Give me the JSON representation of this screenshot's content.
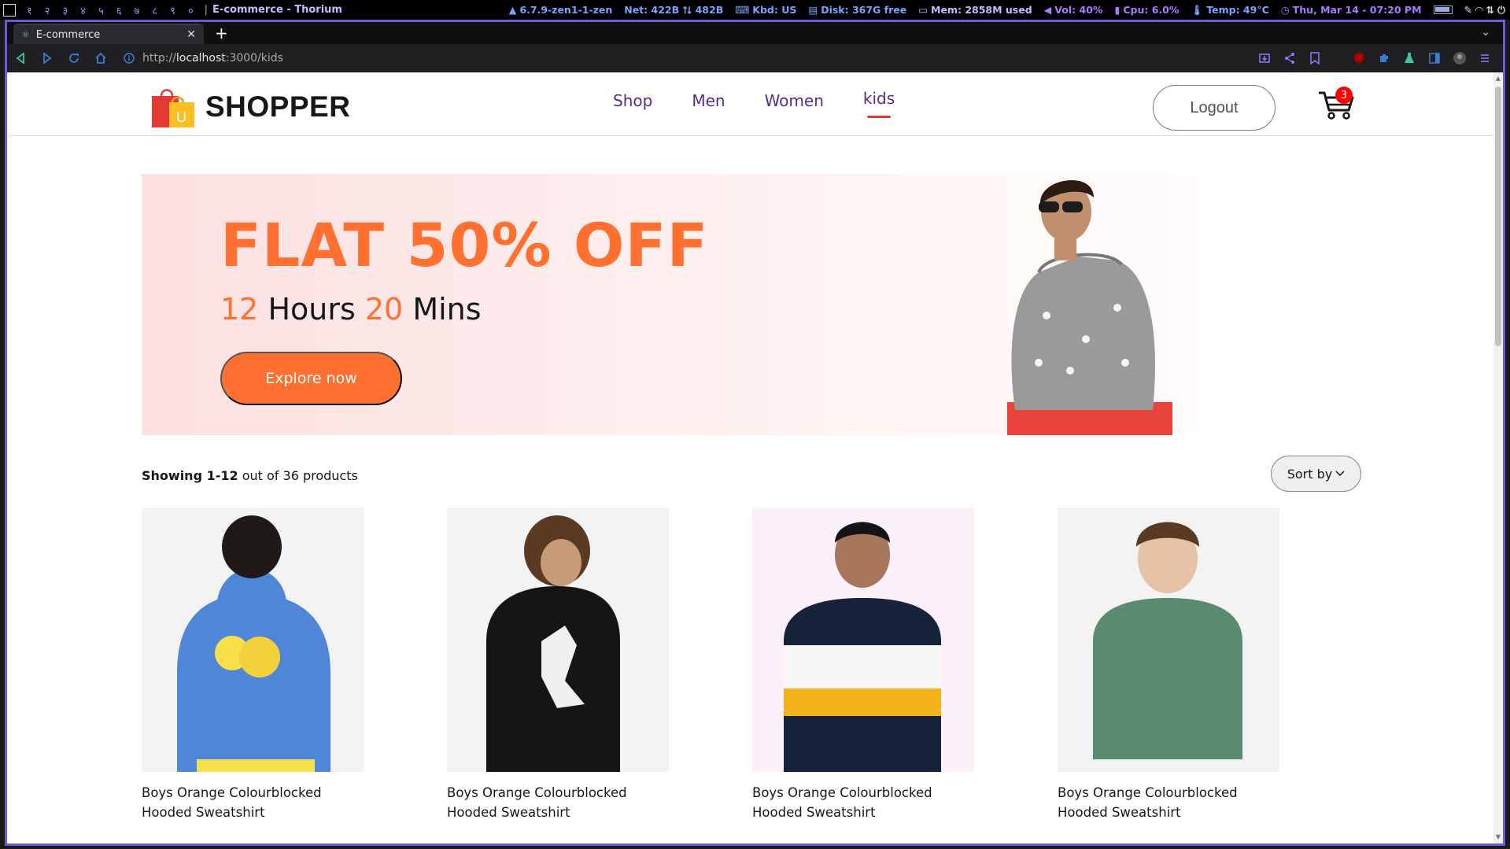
{
  "wm": {
    "workspaces": [
      "१",
      "२",
      "३",
      "४",
      "५",
      "६",
      "७",
      "८",
      "९",
      "०"
    ],
    "window_title": "E-commerce - Thorium",
    "kernel": "6.7.9-zen1-1-zen",
    "net": "Net: 422B ⭡⭣ 482B",
    "kbd": "Kbd: US",
    "disk": "Disk: 367G free",
    "mem": "Mem: 2858M used",
    "vol": "Vol: 40%",
    "cpu": "Cpu: 6.0%",
    "temp": "Temp: 49°C",
    "clock": "Thu, Mar 14 - 07:20 PM"
  },
  "browser": {
    "tab_title": "E-commerce",
    "url_prefix": "http://",
    "url_host": "localhost",
    "url_path": ":3000/kids"
  },
  "navbar": {
    "brand": "SHOPPER",
    "menu": [
      {
        "label": "Shop",
        "active": false
      },
      {
        "label": "Men",
        "active": false
      },
      {
        "label": "Women",
        "active": false
      },
      {
        "label": "kids",
        "active": true
      }
    ],
    "logout_label": "Logout",
    "cart_count": "3"
  },
  "hero": {
    "title": "FLAT 50% OFF",
    "hours": "12",
    "hours_label": "Hours",
    "mins": "20",
    "mins_label": "Mins",
    "cta": "Explore now"
  },
  "listing": {
    "showing_bold": "Showing 1-12",
    "showing_rest": "out of 36 products",
    "sort_label": "Sort by"
  },
  "products": [
    {
      "line1": "Boys Orange Colourblocked",
      "line2": "Hooded Sweatshirt"
    },
    {
      "line1": "Boys Orange Colourblocked",
      "line2": "Hooded Sweatshirt"
    },
    {
      "line1": "Boys Orange Colourblocked",
      "line2": "Hooded Sweatshirt"
    },
    {
      "line1": "Boys Orange Colourblocked",
      "line2": "Hooded Sweatshirt"
    }
  ],
  "colors": {
    "accent": "#ff7031",
    "nav_text": "#5a2a8a",
    "active_underline": "#e53935",
    "badge": "#ff0000",
    "frame_border": "#6b5bd6"
  }
}
